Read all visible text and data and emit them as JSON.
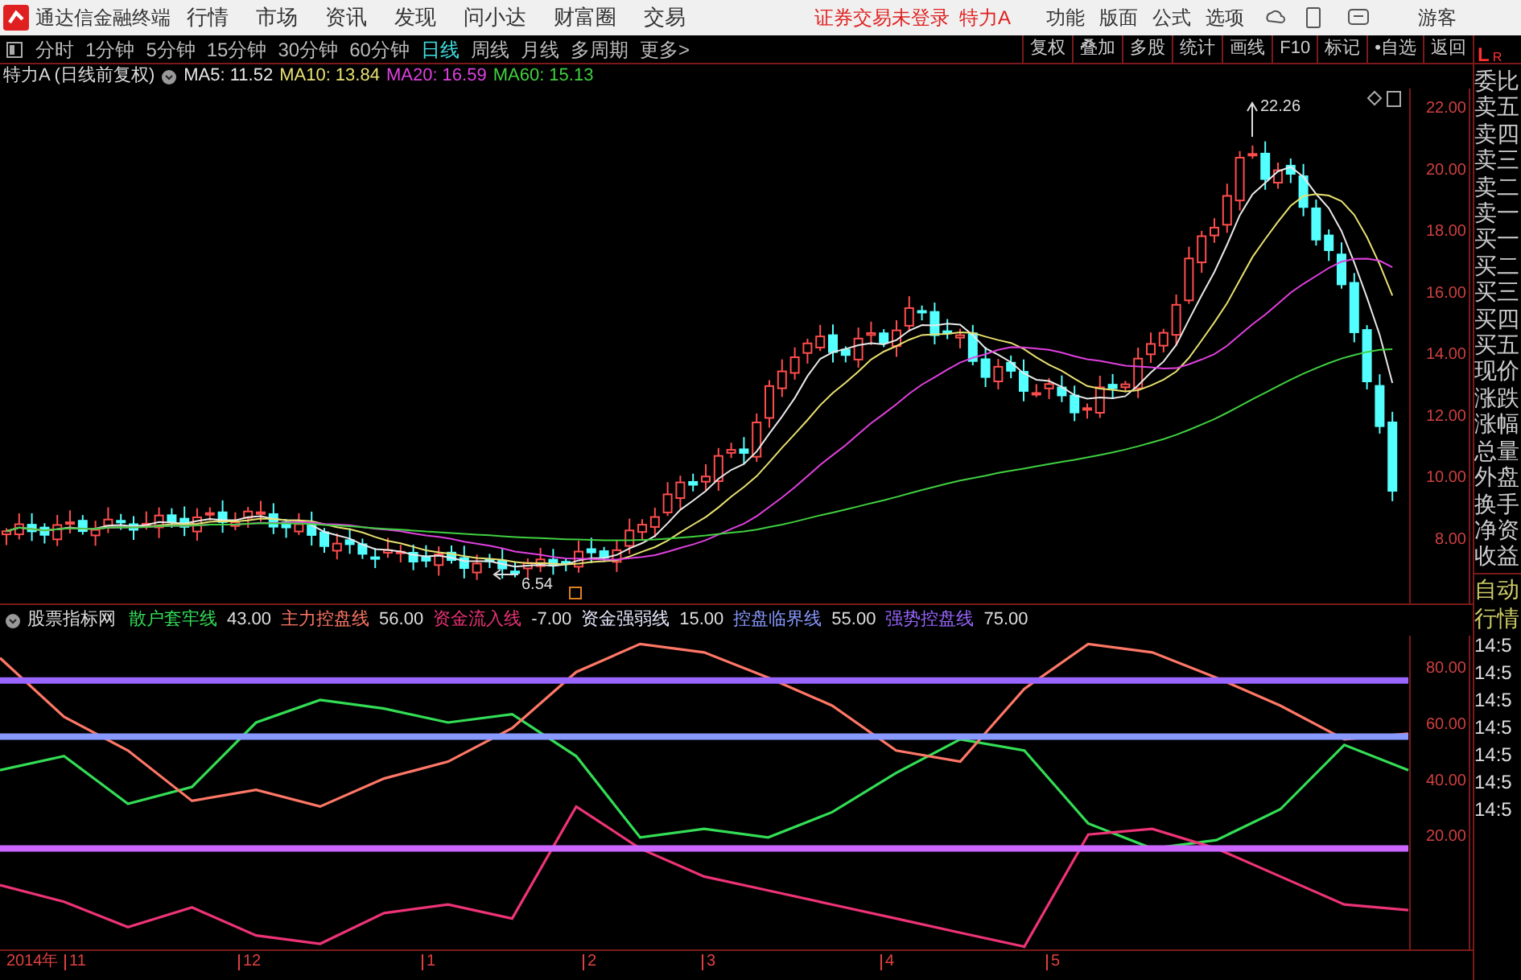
{
  "app": {
    "title": "通达信金融终端",
    "menu": [
      "行情",
      "市场",
      "资讯",
      "发现",
      "问小达",
      "财富圈",
      "交易"
    ],
    "login_status": "证券交易未登录",
    "stock": "特力A",
    "right_menu": [
      "功能",
      "版面",
      "公式",
      "选项"
    ],
    "user": "游客"
  },
  "periods": [
    {
      "label": "分时",
      "selected": false
    },
    {
      "label": "1分钟",
      "selected": false
    },
    {
      "label": "5分钟",
      "selected": false
    },
    {
      "label": "15分钟",
      "selected": false
    },
    {
      "label": "30分钟",
      "selected": false
    },
    {
      "label": "60分钟",
      "selected": false
    },
    {
      "label": "日线",
      "selected": true
    },
    {
      "label": "周线",
      "selected": false
    },
    {
      "label": "月线",
      "selected": false
    },
    {
      "label": "多周期",
      "selected": false
    },
    {
      "label": "更多>",
      "selected": false
    }
  ],
  "tools": [
    "复权",
    "叠加",
    "多股",
    "统计",
    "画线",
    "F10",
    "标记",
    "•自选",
    "返回"
  ],
  "main_chart": {
    "title": "特力A (日线前复权)",
    "ma": [
      {
        "label": "MA5: 11.52",
        "color": "#e8e8e8"
      },
      {
        "label": "MA10: 13.84",
        "color": "#e8e070"
      },
      {
        "label": "MA20: 16.59",
        "color": "#e040e0"
      },
      {
        "label": "MA60: 15.13",
        "color": "#40d040"
      }
    ],
    "price_axis": [
      "22.00",
      "20.00",
      "18.00",
      "16.00",
      "14.00",
      "12.00",
      "10.00",
      "8.00"
    ],
    "marks": [
      {
        "label": "22.26"
      },
      {
        "label": "6.54"
      }
    ]
  },
  "indicator": {
    "title": "股票指标网",
    "legend": [
      {
        "value": "43.00",
        "color": "#33dd55"
      },
      {
        "value": "56.00",
        "color": "#ff7766"
      },
      {
        "value": "-7.00",
        "color": "#ee3377"
      },
      {
        "value": "15.00",
        "color": "#e8e8ff"
      },
      {
        "value": "55.00",
        "color": "#8899ff"
      },
      {
        "value": "75.00",
        "color": "#9966ff"
      }
    ],
    "chart_data": {
      "type": "line",
      "ylim": [
        -21,
        91
      ],
      "yticks": [
        {
          "value": 20,
          "label": "20.00"
        },
        {
          "value": 40,
          "label": "40.00"
        },
        {
          "value": 60,
          "label": "60.00"
        },
        {
          "value": 80,
          "label": "80.00"
        }
      ],
      "series": [
        {
          "name": "散户套牢线",
          "color": "#33dd55",
          "values": [
            43,
            48,
            31,
            37,
            60,
            68,
            65,
            60,
            63,
            48,
            19,
            22,
            19,
            28,
            42,
            54,
            50,
            24,
            15,
            18,
            29,
            52,
            43
          ]
        },
        {
          "name": "主力控盘线",
          "color": "#ff7766",
          "values": [
            83,
            62,
            50,
            32,
            36,
            30,
            40,
            46,
            58,
            78,
            88,
            85,
            76,
            66,
            50,
            46,
            72,
            88,
            85,
            76,
            66,
            54,
            56
          ]
        },
        {
          "name": "资金流入线",
          "color": "#ee3377",
          "values": [
            2,
            -4,
            -13,
            -6,
            -16,
            -19,
            -8,
            -5,
            -10,
            30,
            15,
            5,
            0,
            -5,
            -10,
            -15,
            -20,
            20,
            22,
            15,
            5,
            -5,
            -7
          ]
        },
        {
          "name": "资金强弱线",
          "color": "#cc66ff",
          "values": [
            15,
            15,
            15,
            15,
            15,
            15,
            15,
            15,
            15,
            15,
            15,
            15,
            15,
            15,
            15,
            15,
            15,
            15,
            15,
            15,
            15,
            15,
            15
          ]
        },
        {
          "name": "控盘临界线",
          "color": "#8899ff",
          "values": [
            55,
            55,
            55,
            55,
            55,
            55,
            55,
            55,
            55,
            55,
            55,
            55,
            55,
            55,
            55,
            55,
            55,
            55,
            55,
            55,
            55,
            55,
            55
          ]
        },
        {
          "name": "强势控盘线",
          "color": "#9966ff",
          "values": [
            75,
            75,
            75,
            75,
            75,
            75,
            75,
            75,
            75,
            75,
            75,
            75,
            75,
            75,
            75,
            75,
            75,
            75,
            75,
            75,
            75,
            75,
            75
          ]
        }
      ]
    }
  },
  "date_axis": [
    "2014年",
    "11",
    "12",
    "1",
    "2",
    "3",
    "4",
    "5"
  ],
  "side_header": [
    "L",
    "R"
  ],
  "side_panel": [
    "委比",
    "卖五",
    "卖四",
    "卖三",
    "卖二",
    "卖一",
    "买一",
    "买二",
    "买三",
    "买四",
    "买五",
    "现价",
    "涨跌",
    "涨幅",
    "总量",
    "外盘",
    "换手",
    "净资",
    "收益"
  ],
  "side_tabs": [
    "自动",
    "行情"
  ],
  "side_times": [
    "14:5",
    "14:5",
    "14:5",
    "14:5",
    "14:5",
    "14:5",
    "14:5"
  ]
}
